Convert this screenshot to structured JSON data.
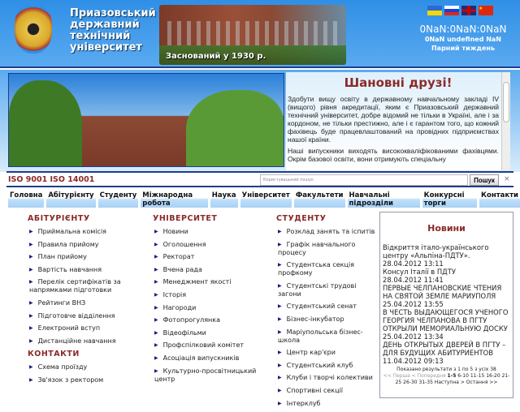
{
  "header": {
    "university_name": [
      "Приазовський",
      "державний",
      "технічний",
      "університет"
    ],
    "founded": "Заснований у 1930 р.",
    "languages": [
      "uk",
      "ru",
      "en",
      "zh"
    ],
    "clock": "0NaN:0NaN:0NaN",
    "date": "0NaN undefined NaN",
    "week": "Парний тиждень"
  },
  "welcome": {
    "title": "Шановні друзі!",
    "p1": "Здобути вищу освіту в державному навчальному закладі IV (вищого) рівня акредитації, яким є Приазовський державний технічний університет, добре відомий не тільки в Україні, але і за кордоном, не тільки престижно, але і є гарантом того, що кожний фахівець буде працевлаштований на провідних підприємствах нашої країни.",
    "p2": "Наші випускники виходять висококваліфікованими фахівцями. Окрім базової освіти, вони отримують спеціальну"
  },
  "iso": "ISO 9001 ISO 14001",
  "search": {
    "placeholder": "Користувацький пошук",
    "button": "Пошук",
    "clear": "×"
  },
  "nav": [
    "Головна",
    "Абітурієнту",
    "Студенту",
    "Міжнародна робота",
    "Наука",
    "Університет",
    "Факультети",
    "Навчальні підрозділи",
    "Конкурсні торги",
    "Контакти"
  ],
  "columns": [
    {
      "title": "АБІТУРІЄНТУ",
      "items": [
        "Приймальна комісія",
        "Правила прийому",
        "План прийому",
        "Вартість навчання",
        "Перелік сертифікатів за напрямками підготовки",
        "Рейтинги ВНЗ",
        "Підготовче відділення",
        "Електроний вступ",
        "Дистанційне навчання"
      ]
    },
    {
      "title": "КОНТАКТИ",
      "items": [
        "Схема проїзду",
        "Зв'язок з ректором"
      ]
    },
    {
      "title": "УНІВЕРСИТЕТ",
      "items": [
        "Новини",
        "Оголошення",
        "Ректорат",
        "Вчена рада",
        "Менеджмент якості",
        "Історія",
        "Нагороди",
        "Фотопрогулянка",
        "Відеофільми",
        "Профспілковий комітет",
        "Асоціація випускників",
        "Культурно-просвітницький центр"
      ]
    },
    {
      "title": "СТУДЕНТУ",
      "items": [
        "Розклад занять та іспитів",
        "Графік навчального процесу",
        "Студентська секція профкому",
        "Студентські трудові загони",
        "Студентський сенат",
        "Бізнес-інкубатор",
        "Маріупольська бізнес-школа",
        "Центр кар'єри",
        "Студентський клуб",
        "Клуби і творчі колективи",
        "Спортивні секції",
        "Інтерклуб"
      ]
    }
  ],
  "news": {
    "title": "Новини",
    "items": [
      {
        "title": "Відкриття італо-українського центру «Альпіна-ПДТУ».",
        "date": "28.04.2012 13:11"
      },
      {
        "title": "Консул Італії в ПДТУ",
        "date": "28.04.2012 11:41"
      },
      {
        "title": "ПЕРВЫЕ ЧЕЛПАНОВСКИЕ ЧТЕНИЯ НА СВЯТОЙ ЗЕМЛЕ МАРИУПОЛЯ",
        "date": "25.04.2012 13:55"
      },
      {
        "title": "В ЧЕСТЬ ВЫДАЮЩЕГОСЯ УЧЕНОГО ГЕОРГИЯ ЧЕЛПАНОВА В ПГТУ ОТКРЫЛИ МЕМОРИАЛЬНУЮ ДОСКУ",
        "date": "25.04.2012 13:34"
      },
      {
        "title": "ДЕНЬ ОТКРЫТЫХ ДВЕРЕЙ В ПГТУ – ДЛЯ БУДУЩИХ АБИТУРИЕНТОВ",
        "date": "11.04.2012 09:13"
      }
    ],
    "summary": "Показано результати з 1 по 5 з усіх 38",
    "pager": {
      "first": "<< Перша",
      "prev": "< Попередня",
      "current": "1-5",
      "pages": [
        "6-10",
        "11-15",
        "16-20",
        "21-25",
        "26-30",
        "31-35"
      ],
      "next": "Наступна >",
      "last": "Остання >>"
    }
  }
}
